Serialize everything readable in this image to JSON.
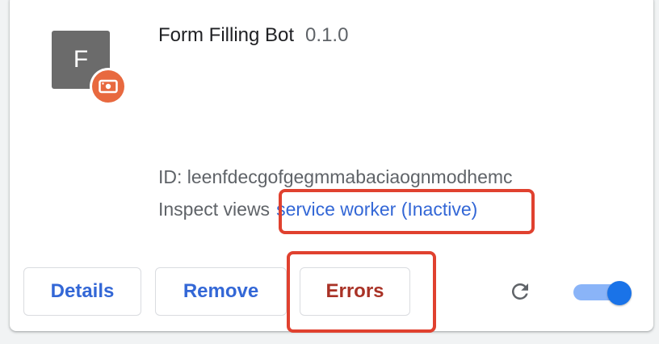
{
  "extension": {
    "icon_letter": "F",
    "badge_icon": "service-worker-badge-icon",
    "name": "Form Filling Bot",
    "version": "0.1.0",
    "id_text": "ID: leenfdecgofgegmmabaciaognmodhemc",
    "inspect_label": "Inspect views",
    "inspect_link": "service worker (Inactive)"
  },
  "actions": {
    "details_label": "Details",
    "remove_label": "Remove",
    "errors_label": "Errors",
    "reload_icon": "reload-icon",
    "toggle_enabled": true
  },
  "colors": {
    "link": "#3367d6",
    "errors_text": "#a93226",
    "highlight": "#e0412f",
    "badge": "#e8693f",
    "toggle_knob": "#1a73e8",
    "toggle_track": "#8ab4f8"
  }
}
